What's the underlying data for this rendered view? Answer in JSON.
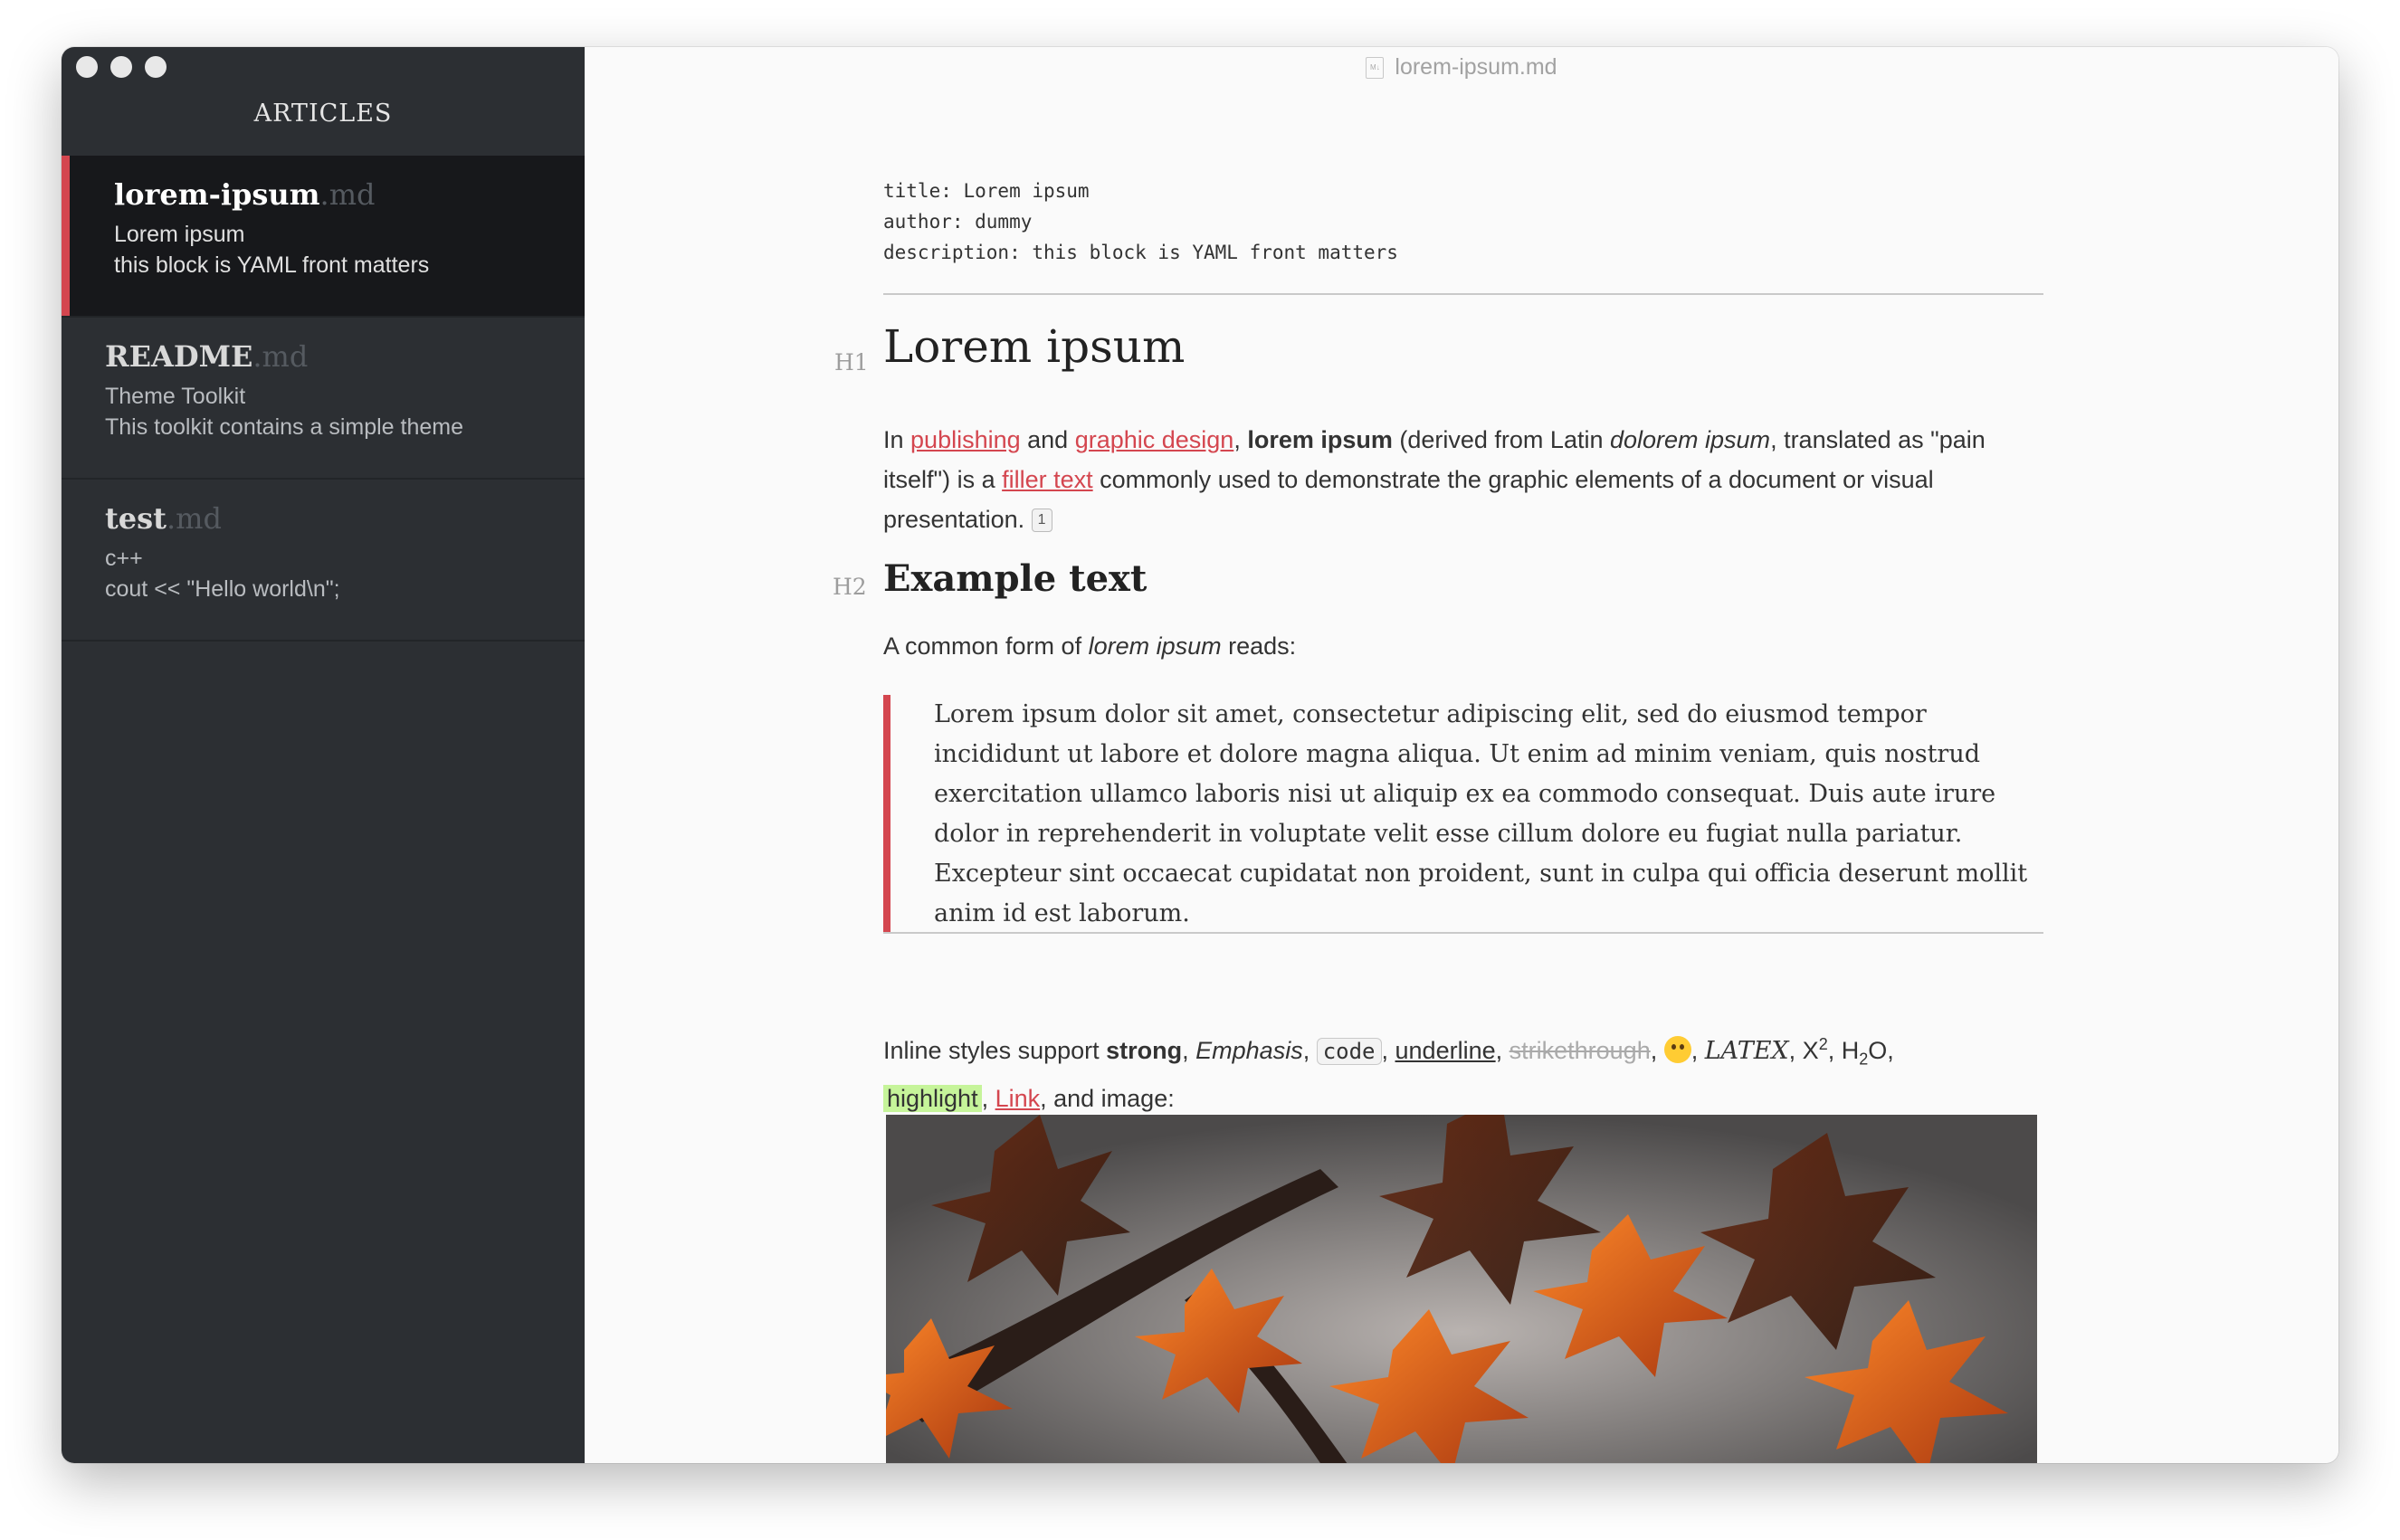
{
  "window": {
    "title": "lorem-ipsum.md"
  },
  "sidebar": {
    "title": "ARTICLES",
    "articles": [
      {
        "name": "lorem-ipsum",
        "ext": ".md",
        "line1": "Lorem ipsum",
        "line2": "this block is YAML front matters",
        "active": true
      },
      {
        "name": "README",
        "ext": ".md",
        "line1": "Theme Toolkit",
        "line2": "This toolkit contains a simple theme",
        "active": false
      },
      {
        "name": "test",
        "ext": ".md",
        "line1": "c++",
        "line2": "cout << \"Hello world\\n\";",
        "active": false
      }
    ]
  },
  "document": {
    "front_matter": [
      "title: Lorem ipsum",
      "author: dummy",
      "description: this block is YAML front matters"
    ],
    "h1_marker": "H1",
    "h1": "Lorem ipsum",
    "intro": {
      "t1": "In ",
      "link1": "publishing",
      "t2": " and ",
      "link2": "graphic design",
      "t3": ", ",
      "bold": "lorem ipsum",
      "t4": " (derived from Latin ",
      "ital": "dolorem ipsum",
      "t5": ", translated as \"pain itself\") is a ",
      "link3": "filler text",
      "t6": " commonly used to demonstrate the graphic elements of a document or visual presentation. ",
      "footnote": "1"
    },
    "h2_marker": "H2",
    "h2": "Example text",
    "common": {
      "t1": "A common form of ",
      "ital": "lorem ipsum",
      "t2": " reads:"
    },
    "blockquote": "Lorem ipsum dolor sit amet, consectetur adipiscing elit, sed do eiusmod tempor incididunt ut labore et dolore magna aliqua. Ut enim ad minim veniam, quis nostrud exercitation ullamco laboris nisi ut aliquip ex ea commodo consequat. Duis aute irure dolor in reprehenderit in voluptate velit esse cillum dolore eu fugiat nulla pariatur. Excepteur sint occaecat cupidatat non proident, sunt in culpa qui officia deserunt mollit anim id est laborum.",
    "inline": {
      "t1": "Inline styles support ",
      "strong": "strong",
      "sep": ", ",
      "emphasis": "Emphasis",
      "code": "code",
      "underline": "underline",
      "strike": "strikethrough",
      "latex": "LATEX",
      "x": "X",
      "x_sup": "2",
      "h": "H",
      "h_sub": "2",
      "o": "O,",
      "highlight": "highlight",
      "link": "Link",
      "t_end": ", and image:"
    },
    "image_alt": "autumn maple leaves photo"
  },
  "colors": {
    "accent": "#d4464f",
    "sidebar_bg": "#2c2f33",
    "active_bg": "#17181b",
    "highlight": "#c6f49a"
  }
}
